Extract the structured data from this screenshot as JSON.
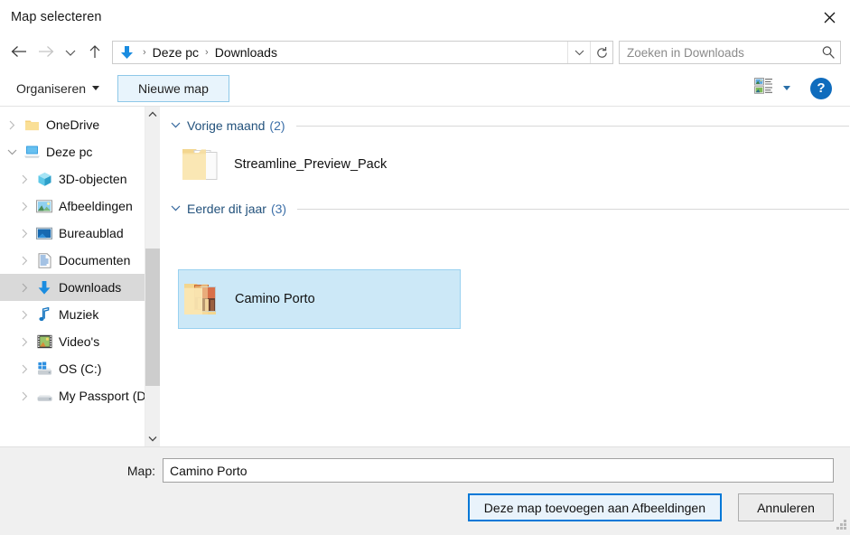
{
  "window": {
    "title": "Map selecteren",
    "close_icon": "close-icon"
  },
  "navbar": {
    "back_icon": "←",
    "forward_icon": "→",
    "recent_icon": "⌄",
    "up_icon": "↑",
    "address": {
      "root_icon": "downloads-arrow-icon",
      "separator": "›",
      "crumbs": [
        "Deze pc",
        "Downloads"
      ],
      "chevron": "⌄",
      "refresh": "↻"
    },
    "search": {
      "placeholder": "Zoeken in Downloads",
      "icon": "search-icon"
    }
  },
  "toolbar": {
    "organize_label": "Organiseren",
    "new_folder_label": "Nieuwe map",
    "view_icon": "view-options-icon",
    "view_caret": "▾",
    "help_label": "?"
  },
  "sidebar": {
    "items": [
      {
        "label": "OneDrive",
        "icon": "onedrive-folder-icon",
        "chevron": "collapsed",
        "indent": 0,
        "selected": false
      },
      {
        "label": "Deze pc",
        "icon": "this-pc-icon",
        "chevron": "expanded",
        "indent": 0,
        "selected": false
      },
      {
        "label": "3D-objecten",
        "icon": "3d-objects-icon",
        "chevron": "collapsed",
        "indent": 1,
        "selected": false
      },
      {
        "label": "Afbeeldingen",
        "icon": "pictures-icon",
        "chevron": "collapsed",
        "indent": 1,
        "selected": false
      },
      {
        "label": "Bureaublad",
        "icon": "desktop-icon",
        "chevron": "collapsed",
        "indent": 1,
        "selected": false
      },
      {
        "label": "Documenten",
        "icon": "documents-icon",
        "chevron": "collapsed",
        "indent": 1,
        "selected": false
      },
      {
        "label": "Downloads",
        "icon": "downloads-icon",
        "chevron": "collapsed",
        "indent": 1,
        "selected": true
      },
      {
        "label": "Muziek",
        "icon": "music-icon",
        "chevron": "collapsed",
        "indent": 1,
        "selected": false
      },
      {
        "label": "Video's",
        "icon": "videos-icon",
        "chevron": "collapsed",
        "indent": 1,
        "selected": false
      },
      {
        "label": "OS (C:)",
        "icon": "windows-drive-icon",
        "chevron": "collapsed",
        "indent": 1,
        "selected": false
      },
      {
        "label": "My Passport (D:)",
        "icon": "external-drive-icon",
        "chevron": "collapsed",
        "indent": 1,
        "selected": false
      }
    ],
    "scroll": {
      "up_arrow": "˄",
      "down_arrow": "˅"
    }
  },
  "content": {
    "groups": [
      {
        "label": "Vorige maand",
        "count": "(2)",
        "chevron": "⌄",
        "items": [
          {
            "label": "Streamline_Preview_Pack",
            "icon": "folder-with-documents-icon",
            "selected": false
          }
        ]
      },
      {
        "label": "Eerder dit jaar",
        "count": "(3)",
        "chevron": "⌄",
        "items": [
          {
            "label": "Camino Porto",
            "icon": "folder-with-photos-icon",
            "selected": true
          }
        ]
      }
    ]
  },
  "footer": {
    "folder_label": "Map:",
    "folder_value": "Camino Porto",
    "confirm_label": "Deze map toevoegen aan Afbeeldingen",
    "cancel_label": "Annuleren"
  },
  "colors": {
    "accent": "#0078d7",
    "selection_fill": "#cce8f7",
    "selection_border": "#99d1f0",
    "sidebar_selection": "#d9d9d9",
    "footer_bg": "#f0f0f0",
    "link_blue": "#23527c"
  }
}
